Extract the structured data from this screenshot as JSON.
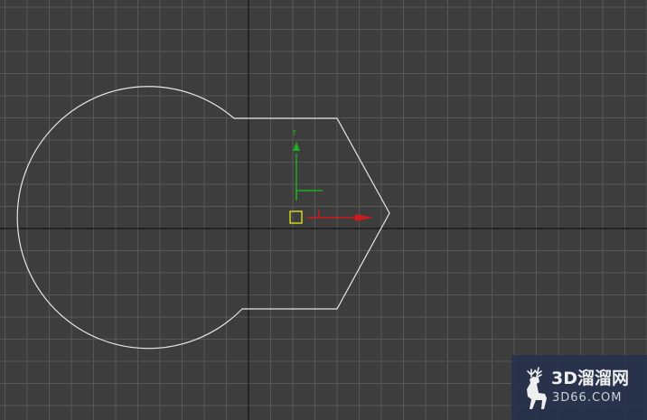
{
  "viewport": {
    "background_color": "#3d3d3d",
    "grid_color": "#575757",
    "axis_color": "#0a0a0a",
    "shape_color": "#e6e6e6"
  },
  "gizmo": {
    "x_axis_color": "#d11a1a",
    "y_axis_color": "#1fae1f",
    "pivot_color": "#e8e81a"
  },
  "watermark": {
    "title": "3D溜溜网",
    "url": "3D66.COM",
    "background_color": "#27324c",
    "logo_icon": "deer-icon"
  }
}
